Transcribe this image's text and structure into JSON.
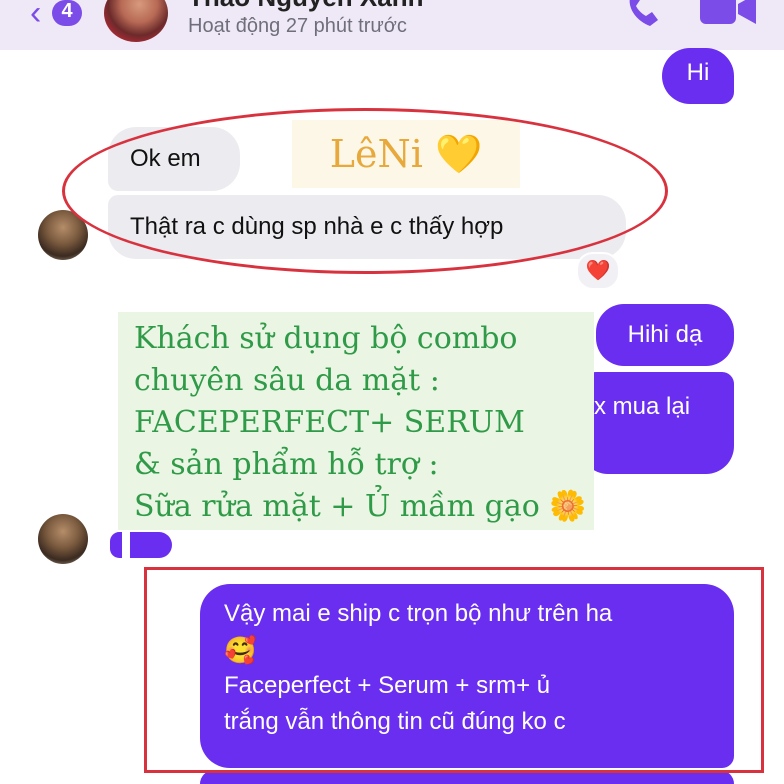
{
  "header": {
    "back_icon": "chevron-left-icon",
    "unread_count": "4",
    "contact_name": "Thảo Nguyễn Xanh",
    "status": "Hoạt động 27 phút trước",
    "call_icon": "phone-icon",
    "video_icon": "video-camera-icon"
  },
  "messages": {
    "hi": "Hi",
    "ok_em": "Ok em",
    "that_ra": "Thật ra c dùng sp nhà e c thấy hợp",
    "reaction": "❤️",
    "hihi": "Hihi dạ",
    "mua_lai": "x mua lại",
    "ship_line1": "Vậy mai e ship c trọn bộ như trên ha",
    "ship_emoji": "🥰",
    "ship_line2": "Faceperfect + Serum + srm+ ủ",
    "ship_line3": "trắng vẫn thông tin cũ đúng ko c"
  },
  "overlays": {
    "leni": "LêNi 💛",
    "note_lines": [
      "Khách sử dụng bộ combo",
      "chuyên sâu da mặt :",
      "FACEPERFECT+ SERUM",
      "& sản phẩm hỗ trợ :",
      "Sữa rửa mặt + Ủ mầm gạo 🌼"
    ]
  },
  "colors": {
    "accent": "#6a2ef0",
    "incoming_bubble": "#ecebef",
    "highlight_red": "#d9323f",
    "note_green": "#2f9a48"
  }
}
